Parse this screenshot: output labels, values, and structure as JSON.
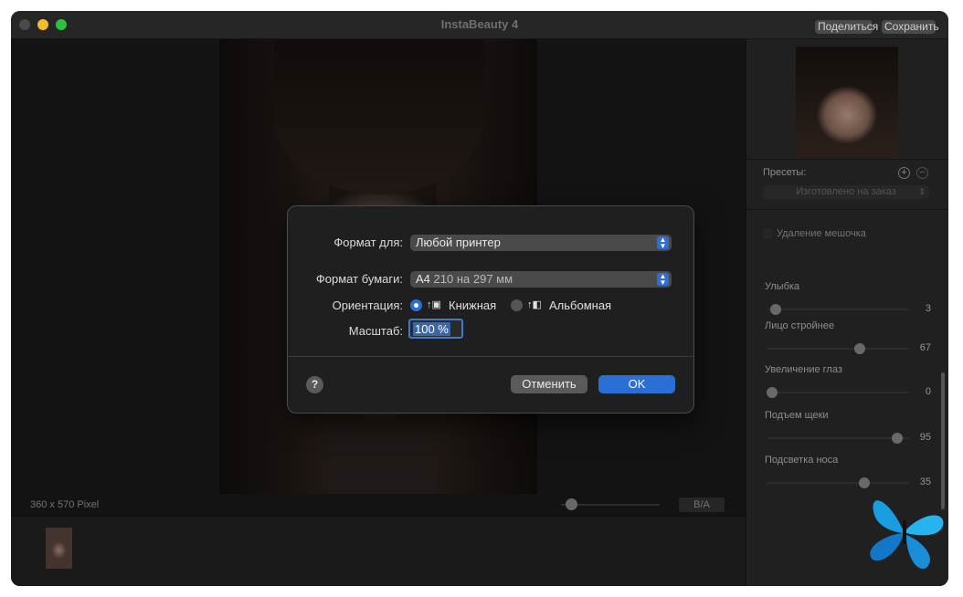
{
  "app": {
    "title": "InstaBeauty 4",
    "share_label": "Поделиться",
    "save_label": "Сохранить"
  },
  "canvas": {
    "pixel_size": "360 x 570 Pixel",
    "before_after_label": "B/A"
  },
  "sidebar": {
    "presets_label": "Пресеты:",
    "preset_value": "Изготовлено на заказ",
    "bag_removal_label": "Удаление мешочка",
    "sliders": [
      {
        "label": "Улыбка",
        "value": "3",
        "fraction": 0.03
      },
      {
        "label": "Лицо стройнее",
        "value": "67",
        "fraction": 0.67
      },
      {
        "label": "Увеличение глаз",
        "value": "0",
        "fraction": 0.0
      },
      {
        "label": "Подъем щеки",
        "value": "95",
        "fraction": 0.95
      },
      {
        "label": "Подсветка носа",
        "value": "35",
        "fraction": 0.7
      }
    ]
  },
  "dialog": {
    "format_for_label": "Формат для:",
    "format_for_value": "Любой принтер",
    "paper_size_label": "Формат бумаги:",
    "paper_size_name": "A4",
    "paper_size_dims": "210 на 297 мм",
    "orientation_label": "Ориентация:",
    "portrait_label": "Книжная",
    "landscape_label": "Альбомная",
    "scale_label": "Масштаб:",
    "scale_value": "100 %",
    "help_label": "?",
    "cancel_label": "Отменить",
    "ok_label": "OK"
  },
  "colors": {
    "accent": "#2a6fd6",
    "background": "#1f1f1f"
  }
}
